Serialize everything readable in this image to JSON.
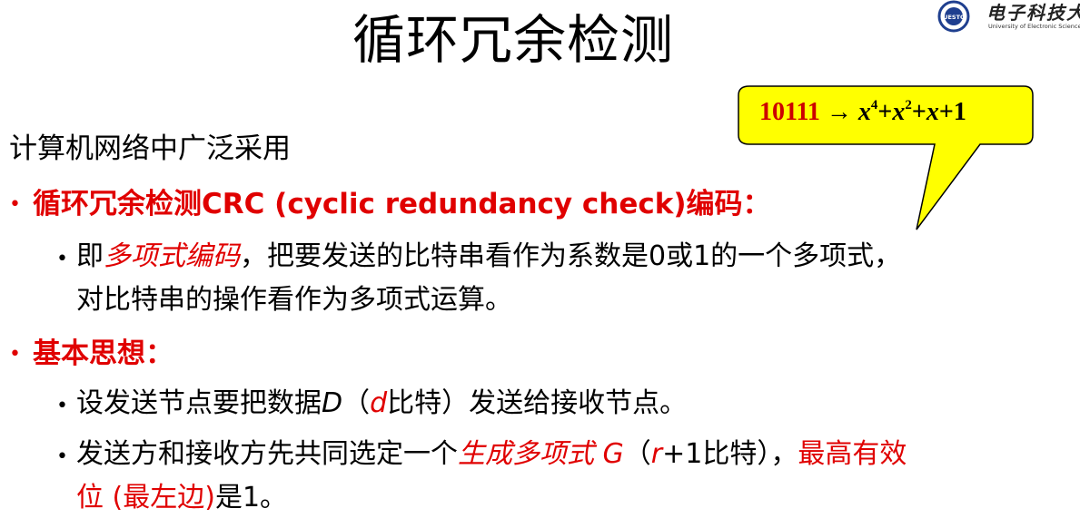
{
  "slide": {
    "title": "循环冗余检测",
    "logo": {
      "seal_text": "UESTC",
      "calligraphy": "电子科技大",
      "english": "University of Electronic Science and Technology"
    },
    "callout": {
      "number": "10111",
      "arrow": "→",
      "x1": "x",
      "e1": "4",
      "plus1": "+",
      "x2": "x",
      "e2": "2",
      "plus2": "+",
      "x3": "x",
      "plus3": "+1"
    },
    "intro": "计算机网络中广泛采用",
    "bullet1": {
      "marker": "•",
      "text": "循环冗余检测CRC (cyclic redundancy check)编码："
    },
    "bullet1_sub": {
      "marker": "•",
      "prefix": "即",
      "highlight": "多项式编码",
      "rest": "，把要发送的比特串看作为系数是0或1的一个多项式，",
      "line2": "对比特串的操作看作为多项式运算。"
    },
    "bullet2": {
      "marker": "•",
      "text": "基本思想："
    },
    "bullet2_sub1": {
      "marker": "•",
      "p1": "设发送节点要把数据",
      "var_D": "D",
      "p2": "（",
      "var_d": "d",
      "p3": "比特）发送给接收节点。"
    },
    "bullet2_sub2": {
      "marker": "•",
      "p1": "发送方和接收方先共同选定一个",
      "highlight": "生成多项式 G",
      "p2": "（",
      "var_r": "r",
      "p3": "+1比特），",
      "red_tail": "最高有效",
      "line2_red": "位 (最左边)",
      "line2_black": "是1。"
    }
  }
}
